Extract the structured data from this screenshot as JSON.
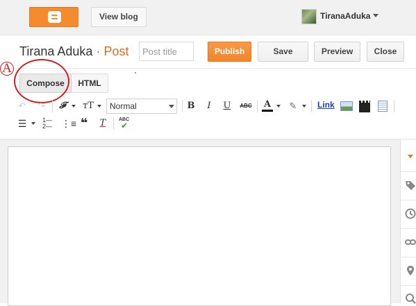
{
  "topbar": {
    "logo": "blogger-logo-icon",
    "view_blog_label": "View blog",
    "username": "TiranaAduka"
  },
  "post_header": {
    "blog_name": "Tirana Aduka",
    "separator": "·",
    "post_label": "Post",
    "title_placeholder": "Post title",
    "title_value": "",
    "publish_label": "Publish",
    "save_label": "Save",
    "preview_label": "Preview",
    "close_label": "Close"
  },
  "annotation": {
    "label": "A",
    "color": "#d42020"
  },
  "mode_tabs": {
    "compose_label": "Compose",
    "html_label": "HTML",
    "active": "Compose"
  },
  "toolbar": {
    "undo_icon": "undo-icon",
    "redo_icon": "redo-icon",
    "font_family_glyph": "𝓕",
    "font_size_glyph": "тT",
    "format_value": "Normal",
    "bold": "B",
    "italic": "I",
    "underline": "U",
    "strikethrough": "ABC",
    "text_color_glyph": "A",
    "highlight_icon": "highlighter-icon",
    "link_label": "Link",
    "image_icon": "image-icon",
    "video_icon": "video-icon",
    "jump_break_icon": "jump-break-icon",
    "align_icon": "align-left-icon",
    "numbered_list_icon": "numbered-list-icon",
    "bullet_list_icon": "bullet-list-icon",
    "quote_glyph": "❝",
    "remove_format_glyph": "T",
    "spellcheck_label": "ABC"
  },
  "editor": {
    "body_text": ""
  },
  "side_panel": {
    "icons": [
      "settings-caret-icon",
      "labels-icon",
      "schedule-icon",
      "permalink-icon",
      "location-icon",
      "search-description-icon"
    ],
    "accent": "#e07a21"
  },
  "colors": {
    "brand_orange": "#f68b2d",
    "publish_orange": "#f28528",
    "link_blue": "#1c3fa5"
  }
}
